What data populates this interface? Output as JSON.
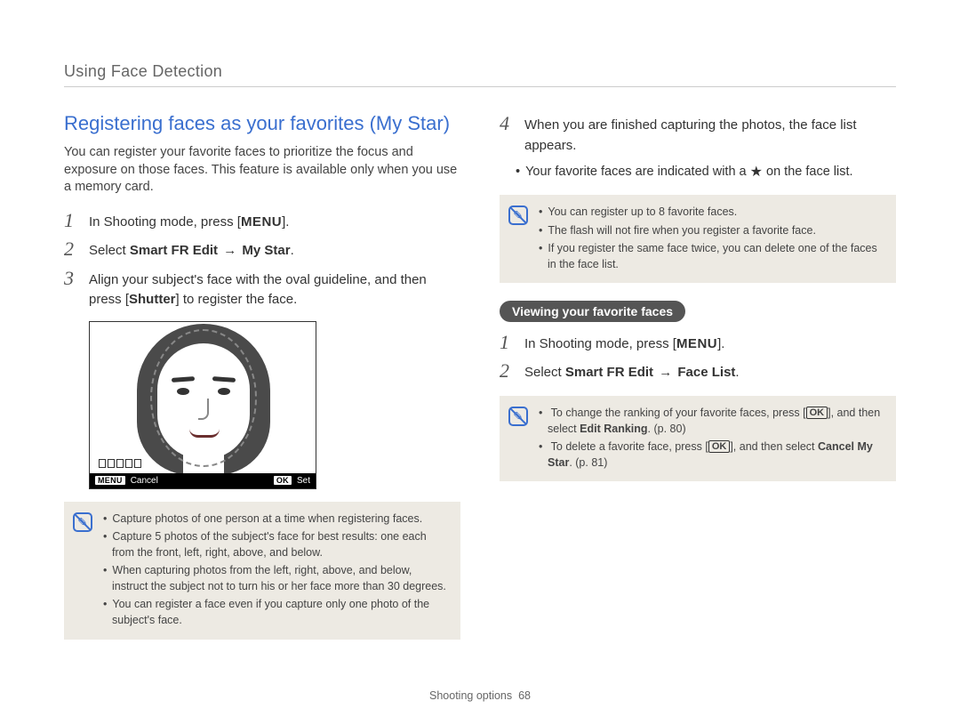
{
  "header": "Using Face Detection",
  "left": {
    "title": "Registering faces as your favorites (My Star)",
    "intro": "You can register your favorite faces to prioritize the focus and exposure on those faces. This feature is available only when you use a memory card.",
    "step1_pre": "In Shooting mode, press [",
    "step1_menu": "MENU",
    "step1_post": "].",
    "step2_pre": "Select ",
    "step2_bold": "Smart FR Edit",
    "step2_arrow": " → ",
    "step2_bold2": "My Star",
    "step2_post": ".",
    "step3": "Align your subject's face with the oval guideline, and then press [",
    "step3_bold": "Shutter",
    "step3_post": "] to register the face.",
    "lcd": {
      "menu": "MENU",
      "cancel": "Cancel",
      "ok": "OK",
      "set": "Set"
    },
    "note1": {
      "b1": "Capture photos of one person at a time when registering faces.",
      "b2": "Capture 5 photos of the subject's face for best results: one each from the front, left, right, above, and below.",
      "b3": "When capturing photos from the left, right, above, and below, instruct the subject not to turn his or her face more than 30 degrees.",
      "b4": "You can register a face even if you capture only one photo of the subject's face."
    }
  },
  "right": {
    "step4": "When you are finished capturing the photos, the face list appears.",
    "step4_sub_pre": "Your favorite faces are indicated with a ",
    "step4_sub_post": " on the face list.",
    "note2": {
      "b1": "You can register up to 8 favorite faces.",
      "b2": "The flash will not fire when you register a favorite face.",
      "b3": "If you register the same face twice, you can delete one of the faces in the face list."
    },
    "pill": "Viewing your favorite faces",
    "v_step1_pre": "In Shooting mode, press [",
    "v_step1_menu": "MENU",
    "v_step1_post": "].",
    "v_step2_pre": "Select ",
    "v_step2_bold": "Smart FR Edit",
    "v_step2_arrow": " → ",
    "v_step2_bold2": "Face List",
    "v_step2_post": ".",
    "note3": {
      "b1_pre": "To change the ranking of your favorite faces, press [",
      "b1_post": "], and then select ",
      "b1_bold": "Edit Ranking",
      "b1_page": ". (p. 80)",
      "b2_pre": "To delete a favorite face, press [",
      "b2_post": "], and then select ",
      "b2_bold": "Cancel My Star",
      "b2_page": ". (p. 81)",
      "ok": "OK"
    }
  },
  "footer_label": "Shooting options",
  "footer_page": "68"
}
